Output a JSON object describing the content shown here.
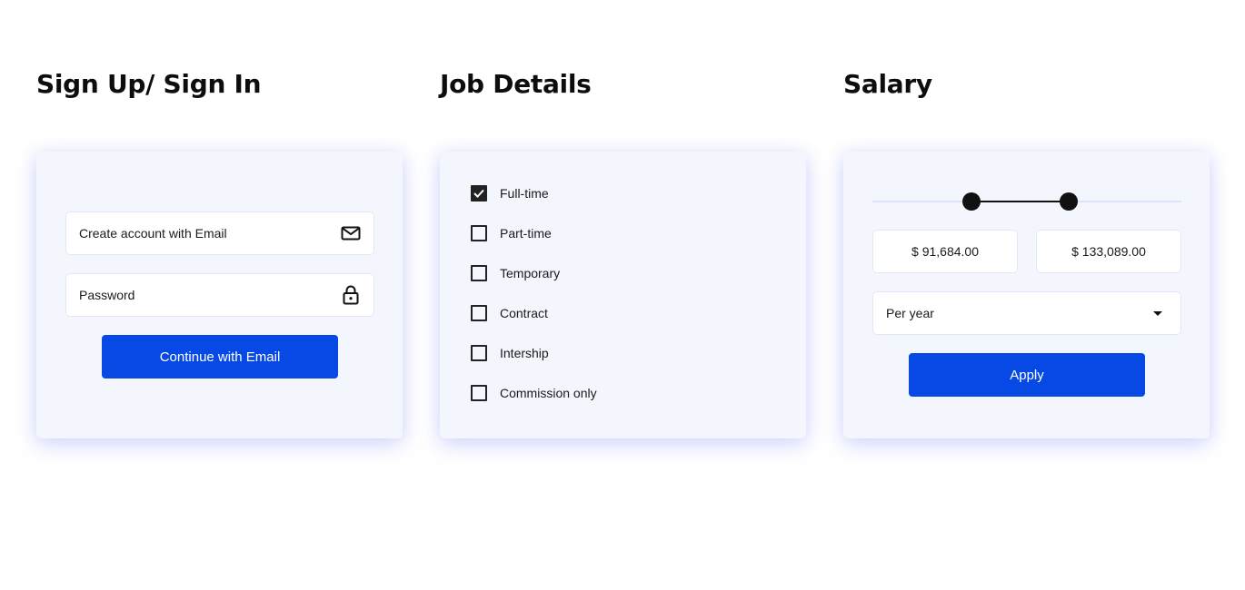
{
  "signup": {
    "heading": "Sign Up/ Sign In",
    "email_field": {
      "placeholder": "Create account with Email",
      "icon": "mail-icon"
    },
    "password_field": {
      "placeholder": "Password",
      "icon": "lock-icon"
    },
    "continue_button": "Continue with Email"
  },
  "job": {
    "heading": "Job Details",
    "options": [
      {
        "label": "Full-time",
        "checked": true
      },
      {
        "label": "Part-time",
        "checked": false
      },
      {
        "label": "Temporary",
        "checked": false
      },
      {
        "label": "Contract",
        "checked": false
      },
      {
        "label": "Intership",
        "checked": false
      },
      {
        "label": "Commission only",
        "checked": false
      }
    ]
  },
  "salary": {
    "heading": "Salary",
    "range": {
      "min_fraction": 0.32,
      "max_fraction": 0.635
    },
    "min_value": "$ 91,684.00",
    "max_value": "$ 133,089.00",
    "period_select": "Per year",
    "apply_button": "Apply"
  },
  "colors": {
    "accent": "#0649e5",
    "card_bg": "#f4f6fe",
    "text": "#111111"
  }
}
